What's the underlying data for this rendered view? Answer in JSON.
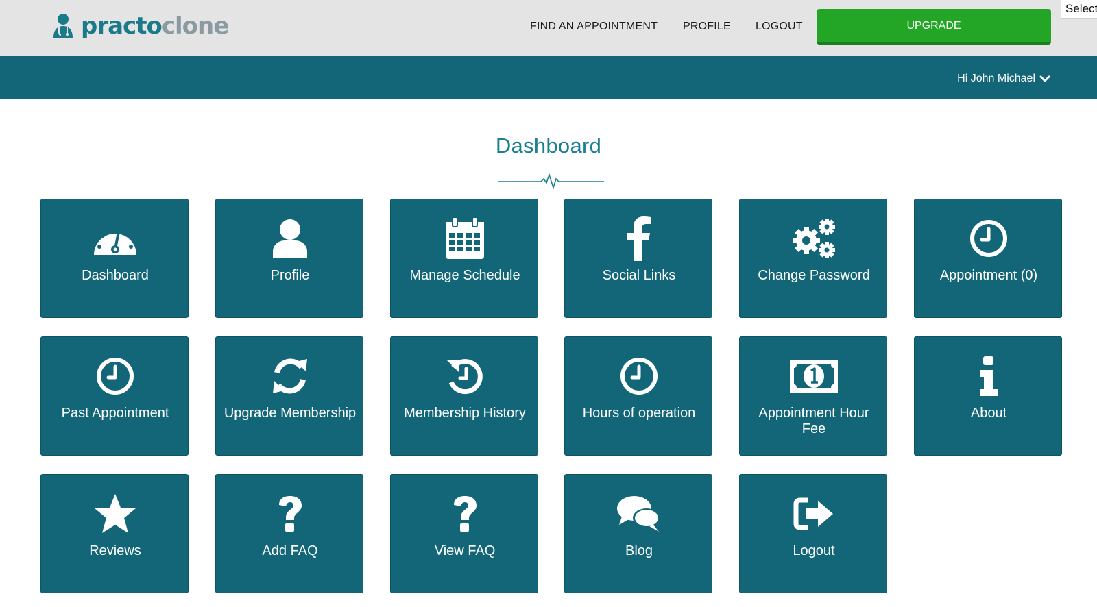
{
  "header": {
    "logo": {
      "part1": "practo",
      "part2": "clone"
    },
    "nav": [
      {
        "label": "FIND AN APPOINTMENT"
      },
      {
        "label": "PROFILE"
      },
      {
        "label": "LOGOUT"
      }
    ],
    "upgrade_label": "UPGRADE",
    "select_label": "Select"
  },
  "subheader": {
    "greeting": "Hi John Michael"
  },
  "main": {
    "title": "Dashboard",
    "tiles": [
      {
        "label": "Dashboard",
        "icon": "dashboard-icon"
      },
      {
        "label": "Profile",
        "icon": "user-icon"
      },
      {
        "label": "Manage Schedule",
        "icon": "calendar-icon"
      },
      {
        "label": "Social Links",
        "icon": "facebook-icon"
      },
      {
        "label": "Change Password",
        "icon": "gears-icon"
      },
      {
        "label": "Appointment (0)",
        "icon": "clock-icon"
      },
      {
        "label": "Past Appointment",
        "icon": "clock-icon"
      },
      {
        "label": "Upgrade Membership",
        "icon": "refresh-icon"
      },
      {
        "label": "Membership History",
        "icon": "history-icon"
      },
      {
        "label": "Hours of operation",
        "icon": "clock-icon"
      },
      {
        "label": "Appointment Hour Fee",
        "icon": "money-icon"
      },
      {
        "label": "About",
        "icon": "info-icon"
      },
      {
        "label": "Reviews",
        "icon": "star-icon"
      },
      {
        "label": "Add FAQ",
        "icon": "question-icon"
      },
      {
        "label": "View FAQ",
        "icon": "question-icon"
      },
      {
        "label": "Blog",
        "icon": "comments-icon"
      },
      {
        "label": "Logout",
        "icon": "sign-out-icon"
      }
    ]
  },
  "colors": {
    "brand_teal": "#126678",
    "title_teal": "#1a7f90",
    "upgrade_green": "#23a625",
    "topbar_gray": "#e4e4e4"
  }
}
